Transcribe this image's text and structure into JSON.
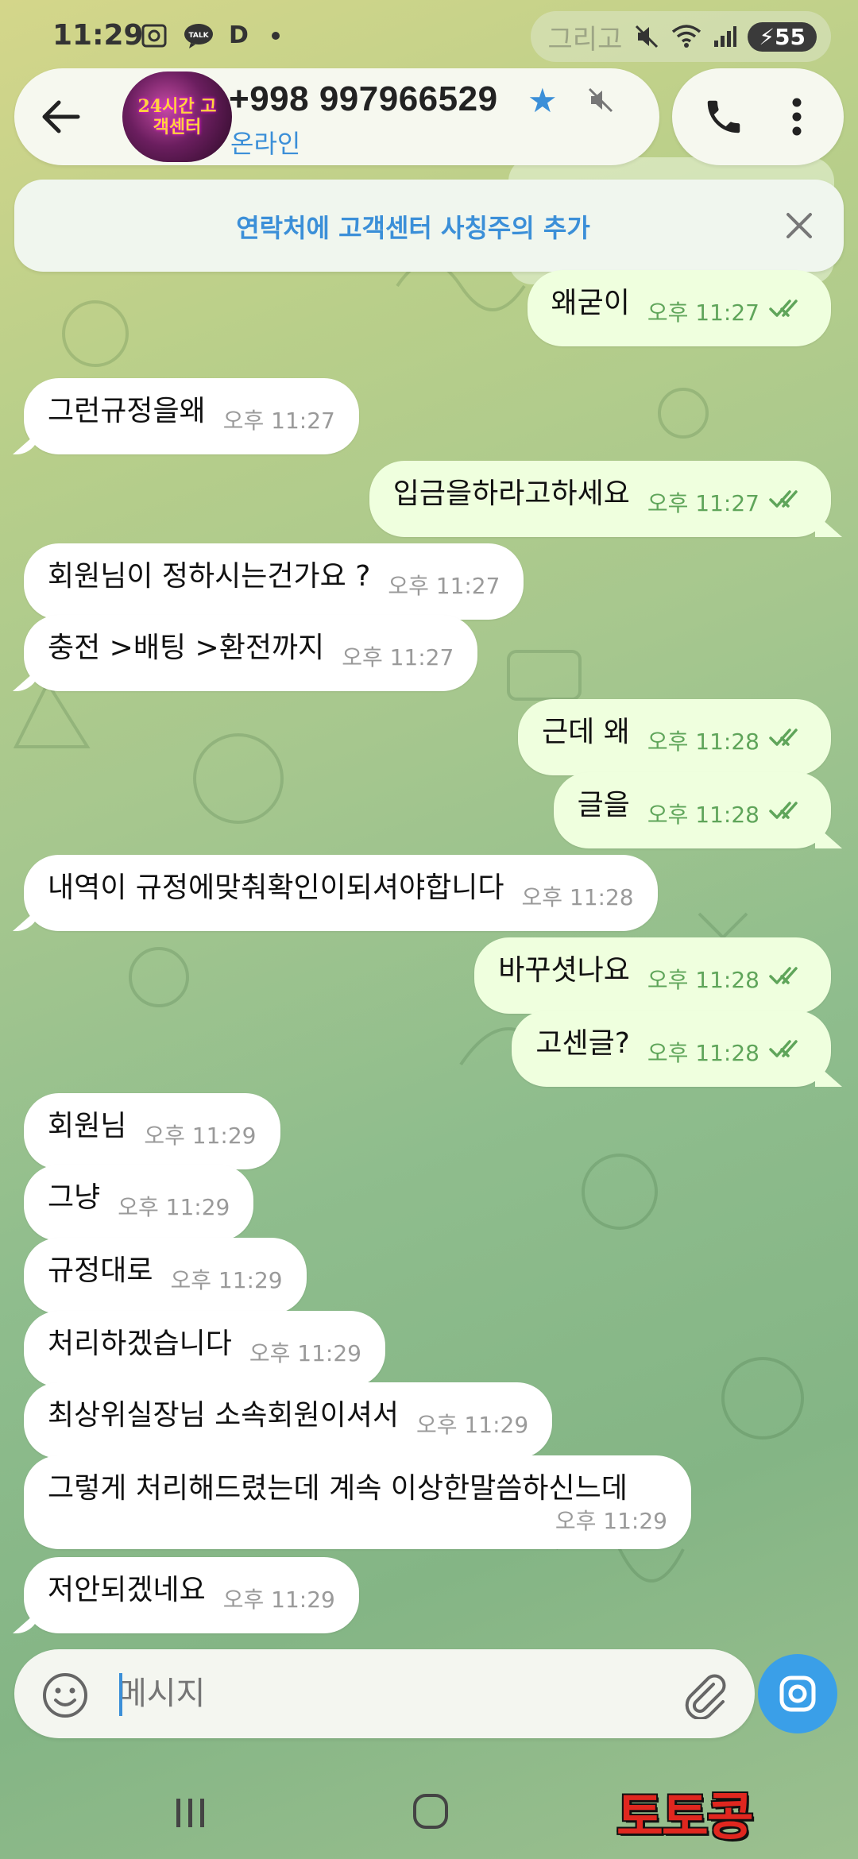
{
  "status_bar": {
    "time": "11:29",
    "left_icons": [
      "screenshot-icon",
      "kakaotalk-icon",
      "D",
      "dot"
    ],
    "ghost_text": "그리고",
    "battery": "55"
  },
  "header": {
    "contact_name": "+998 997966529",
    "status": "온라인",
    "avatar_text": "24시간 고객센터"
  },
  "banner": {
    "text": "연락처에 고객센터 사칭주의 추가"
  },
  "messages": [
    {
      "dir": "out",
      "text": "왜굳이",
      "time": "오후 11:27"
    },
    {
      "dir": "in",
      "text": "그런규정을왜",
      "time": "오후 11:27"
    },
    {
      "dir": "out",
      "text": "입금을하라고하세요",
      "time": "오후 11:27"
    },
    {
      "dir": "in",
      "text": "회원님이 정하시는건가요 ?",
      "time": "오후 11:27"
    },
    {
      "dir": "in",
      "text": "충전 >배팅 >환전까지",
      "time": "오후 11:27"
    },
    {
      "dir": "out",
      "text": "근데 왜",
      "time": "오후 11:28"
    },
    {
      "dir": "out",
      "text": "글을",
      "time": "오후 11:28"
    },
    {
      "dir": "in",
      "text": "내역이 규정에맞춰확인이되셔야합니다",
      "time": "오후 11:28"
    },
    {
      "dir": "out",
      "text": "바꾸셧나요",
      "time": "오후 11:28"
    },
    {
      "dir": "out",
      "text": "고센글?",
      "time": "오후 11:28"
    },
    {
      "dir": "in",
      "text": "회원님",
      "time": "오후 11:29"
    },
    {
      "dir": "in",
      "text": "그냥",
      "time": "오후 11:29"
    },
    {
      "dir": "in",
      "text": "규정대로",
      "time": "오후 11:29"
    },
    {
      "dir": "in",
      "text": "처리하겠습니다",
      "time": "오후 11:29"
    },
    {
      "dir": "in",
      "text": "최상위실장님 소속회원이셔서",
      "time": "오후 11:29"
    },
    {
      "dir": "in",
      "text": "그렇게 처리해드렸는데 계속 이상한말씀하신느데",
      "time": "오후 11:29"
    },
    {
      "dir": "in",
      "text": "저안되겠네요",
      "time": "오후 11:29"
    }
  ],
  "input": {
    "placeholder": "메시지"
  },
  "watermark": "토토콩",
  "colors": {
    "accent": "#3b8fd8",
    "outgoing_bubble": "#efffde",
    "incoming_bubble": "#ffffff",
    "read_ticks": "#5fa55a",
    "watermark": "#e0271f"
  }
}
